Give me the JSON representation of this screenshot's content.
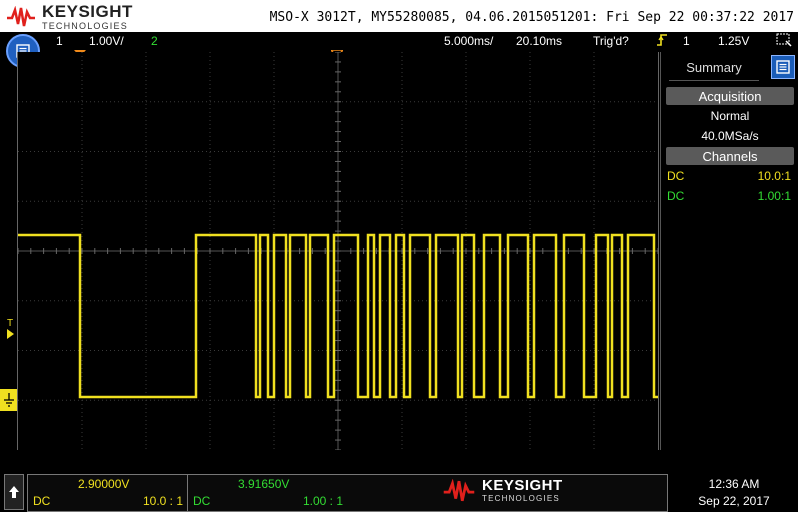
{
  "header": {
    "brand": "KEYSIGHT",
    "brand_sub": "TECHNOLOGIES",
    "model_info": "MSO-X 3012T, MY55280085, 04.06.2015051201: Fri Sep 22 00:37:22 2017"
  },
  "status": {
    "ch1_num": "1",
    "ch1_scale": "1.00V/",
    "ch2_num": "2",
    "timebase": "5.000ms/",
    "delay": "20.10ms",
    "trig_state": "Trig'd?",
    "trig_source": "1",
    "trig_level": "1.25V"
  },
  "side_panel": {
    "tab_label": "Summary",
    "acquisition_head": "Acquisition",
    "acq_mode": "Normal",
    "sample_rate": "40.0MSa/s",
    "channels_head": "Channels",
    "ch1_coupling": "DC",
    "ch1_probe": "10.0:1",
    "ch2_coupling": "DC",
    "ch2_probe": "1.00:1"
  },
  "markers": {
    "trigger_level_label": "T"
  },
  "bottom": {
    "ch1_value": "2.90000V",
    "ch1_coupling": "DC",
    "ch1_probe": "10.0 : 1",
    "ch2_value": "3.91650V",
    "ch2_coupling": "DC",
    "ch2_probe": "1.00 : 1",
    "brand": "KEYSIGHT",
    "brand_sub": "TECHNOLOGIES",
    "time": "12:36 AM",
    "date": "Sep 22, 2017"
  },
  "colors": {
    "ch1": "#f0e020",
    "ch2": "#33dd33",
    "accent_blue": "#2060c0",
    "brand_red": "#e0201c"
  },
  "icons": [
    "keysight-wave-logo",
    "menu-icon",
    "trigger-edge-icon",
    "panel-tab-icon",
    "up-arrow-icon",
    "ground-icon"
  ]
}
